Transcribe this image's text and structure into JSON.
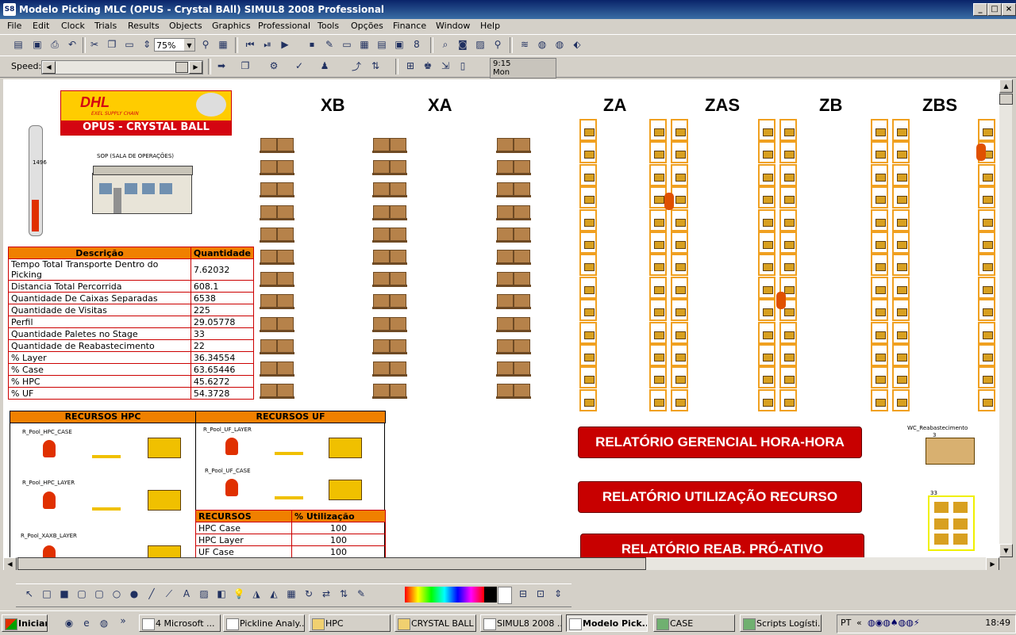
{
  "window": {
    "title": "Modelo Picking MLC (OPUS - Crystal BAll)   SIMUL8 2008 Professional",
    "app_icon": "S8"
  },
  "menu": [
    "File",
    "Edit",
    "Clock",
    "Trials",
    "Results",
    "Objects",
    "Graphics",
    "Professional",
    "Tools",
    "Opções",
    "Finance",
    "Window",
    "Help"
  ],
  "toolbar": {
    "zoom": "75%",
    "speed_label": "Speed:",
    "clock_time": "9:15",
    "clock_day": "Mon"
  },
  "zones": [
    "XB",
    "XA",
    "ZA",
    "ZAS",
    "ZB",
    "ZBS"
  ],
  "logo": {
    "brand": "DHL",
    "tagline": "EXEL SUPPLY CHAIN",
    "subtitle": "OPUS - CRYSTAL BALL"
  },
  "gauge_value": "1496",
  "sop_label": "SOP (SALA DE OPERAÇÕES)",
  "kpi": {
    "headers": [
      "Descrição",
      "Quantidade"
    ],
    "rows": [
      [
        "Tempo Total Transporte Dentro do Picking",
        "7.62032"
      ],
      [
        "Distancia Total Percorrida",
        "608.1"
      ],
      [
        "Quantidade De Caixas Separadas",
        "6538"
      ],
      [
        "Quantidade de Visitas",
        "225"
      ],
      [
        "Perfil",
        "29.05778"
      ],
      [
        "Quantidade Paletes no Stage",
        "33"
      ],
      [
        "Quantidade de Reabastecimento",
        "22"
      ],
      [
        "% Layer",
        "36.34554"
      ],
      [
        "% Case",
        "63.65446"
      ],
      [
        "% HPC",
        "45.6272"
      ],
      [
        "% UF",
        "54.3728"
      ]
    ]
  },
  "rec_hpc": {
    "title": "RECURSOS HPC",
    "pools": [
      "R_Pool_HPC_CASE",
      "R_Pool_HPC_LAYER",
      "R_Pool_XAXB_LAYER"
    ]
  },
  "rec_uf": {
    "title": "RECURSOS UF",
    "pools": [
      "R_Pool_UF_LAYER",
      "R_Pool_UF_CASE"
    ]
  },
  "util": {
    "headers": [
      "RECURSOS",
      "% Utilização"
    ],
    "rows": [
      [
        "HPC Case",
        "100"
      ],
      [
        "HPC Layer",
        "100"
      ],
      [
        "UF Case",
        "100"
      ]
    ]
  },
  "reports": [
    "RELATÓRIO GERENCIAL HORA-HORA",
    "RELATÓRIO UTILIZAÇÃO RECURSO",
    "RELATÓRIO REAB. PRÓ-ATIVO"
  ],
  "wc_label": "WC_Reabastecimento",
  "wc_count": "3",
  "stage_count": "33",
  "taskbar": {
    "start": "Iniciar",
    "tasks": [
      "4 Microsoft ...",
      "Pickline Analy...",
      "HPC",
      "CRYSTAL BALL",
      "SIMUL8 2008 ...",
      "Modelo Pick...",
      "CASE",
      "Scripts Logísti..."
    ],
    "time": "18:49"
  }
}
